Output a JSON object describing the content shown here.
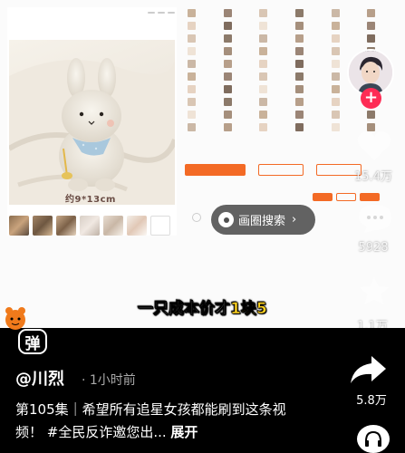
{
  "product": {
    "size_label": "约9*13cm"
  },
  "search": {
    "label": "画圈搜索",
    "chevron": "›"
  },
  "caption": {
    "prefix": "一只成本价才",
    "highlight": "1块5"
  },
  "rail": {
    "like_count": "15.4万",
    "comment_count": "5928",
    "favorite_count": "1.1万",
    "share_count": "5.8万"
  },
  "danmu": {
    "button_label": "弹"
  },
  "post": {
    "author": "@川烈",
    "time": "· 1小时前",
    "description": "第105集｜希望所有追星女孩都能刷到这条视频！ #全民反诈邀您出... ",
    "expand_label": "展开"
  },
  "icons": [
    "search-circle-icon",
    "plus-icon",
    "heart-icon",
    "comment-icon",
    "star-icon",
    "share-arrow-icon",
    "headset-icon",
    "danmu-icon"
  ],
  "colors": {
    "accent_orange": "#f36a25",
    "follow_red": "#fe2c55",
    "caption_yellow": "#ffd21e"
  }
}
